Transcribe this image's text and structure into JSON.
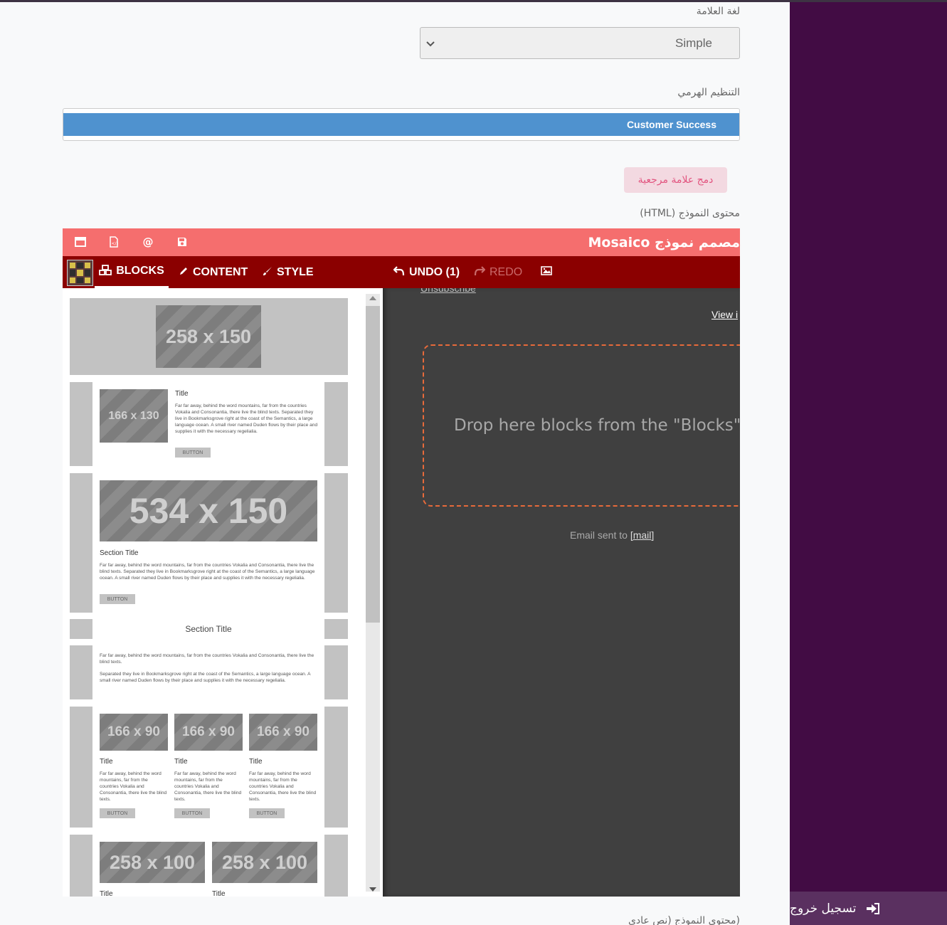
{
  "form": {
    "brand_language_label": "لغة العلامة",
    "brand_language_value": "Simple",
    "hierarchy_label": "التنظيم الهرمي",
    "hierarchy_tag": "Customer Success",
    "merge_button": "دمج علامة مرجعية",
    "template_html_label": "محتوى النموذج (HTML)",
    "template_text_label": "(محتوى النموذج (نص عادي"
  },
  "editor": {
    "title": "مصمم نموذج Mosaico",
    "toolbar_icons": [
      "window-icon",
      "code-file-icon",
      "at-icon",
      "save-icon"
    ],
    "tabs": {
      "blocks": "BLOCKS",
      "content": "CONTENT",
      "style": "STYLE",
      "undo": "UNDO (1)",
      "redo": "REDO"
    },
    "blocks": {
      "b1_image": "258 x 150",
      "b2_image": "166 x 130",
      "b2_title": "Title",
      "b2_text": "Far far away, behind the word mountains, far from the countries Vokalia and Consonantia, there live the blind texts. Separated they live in Bookmarksgrove right at the coast of the Semantics, a large language ocean. A small river named Duden flows by their place and supplies it with the necessary regelialia.",
      "button": "BUTTON",
      "b3_image": "534 x 150",
      "b3_title": "Section Title",
      "b3_text": "Far far away, behind the word mountains, far from the countries Vokalia and Consonantia, there live the blind texts. Separated they live in Bookmarksgrove right at the coast of the Semantics, a large language ocean. A small river named Duden flows by their place and supplies it with the necessary regelialia.",
      "b4_title": "Section Title",
      "b5_text1": "Far far away, behind the word mountains, far from the countries Vokalia and Consonantia, there live the blind texts.",
      "b5_text2": "Separated they live in Bookmarksgrove right at the coast of the Semantics, a large language ocean. A small river named Duden flows by their place and supplies it with the necessary regelialia.",
      "b6_image": "166 x 90",
      "b6_title": "Title",
      "b6_text": "Far far away, behind the word mountains, far from the countries Vokalia and Consonantia, there live the blind texts.",
      "b7_image": "258 x 100",
      "b7_title": "Title"
    },
    "canvas": {
      "unsubscribe": "Unsubscribe",
      "view_in": "View i",
      "drop_text": "Drop here blocks from the \"Blocks\"",
      "email_sent_to": "Email sent to",
      "mail": "[mail]"
    }
  },
  "sidebar": {
    "logout": "تسجيل خروج"
  },
  "colors": {
    "sidebar": "#420c44",
    "editor_top": "#f56e6e",
    "editor_bar": "#8b0000",
    "tag": "#4f92cf",
    "dropzone_border": "#e86a3a"
  }
}
